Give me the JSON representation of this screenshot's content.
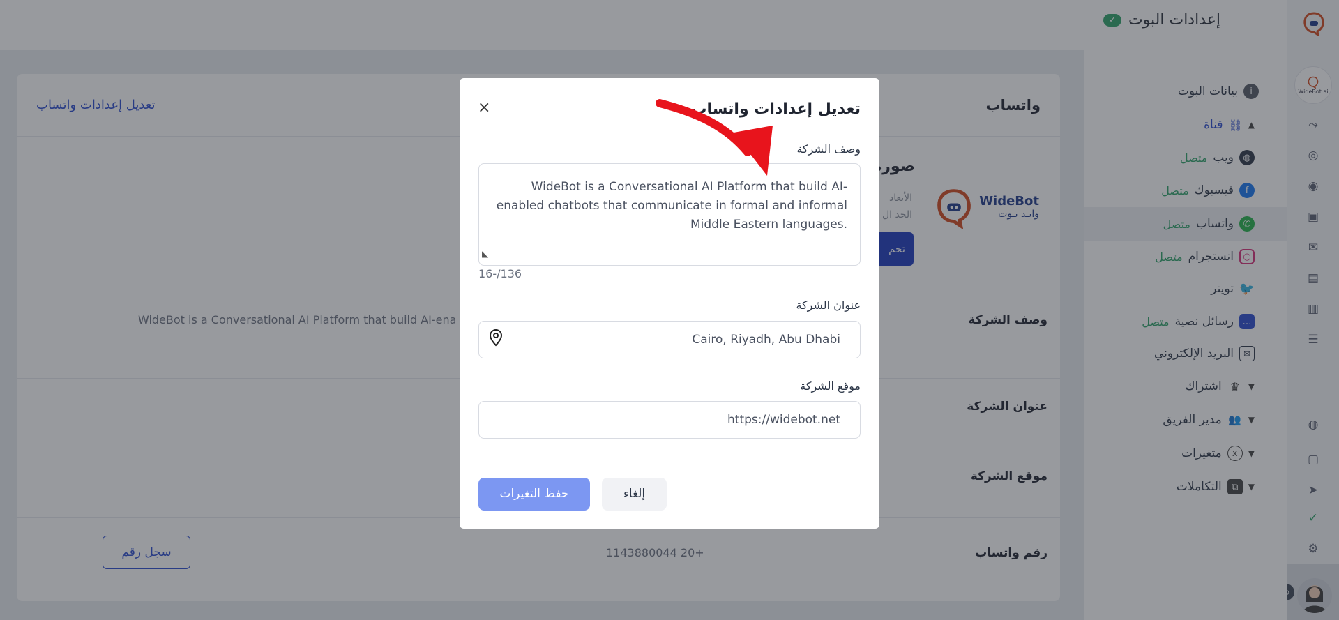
{
  "header": {
    "title": "إعدادات البوت"
  },
  "rail": {
    "logo_text": "WideBot.ai"
  },
  "sidebar": {
    "items": [
      {
        "label": "بيانات البوت"
      },
      {
        "label": "قناة"
      },
      {
        "label": "ويب",
        "status": "متصل"
      },
      {
        "label": "فيسبوك",
        "status": "متصل"
      },
      {
        "label": "واتساب",
        "status": "متصل"
      },
      {
        "label": "انستجرام",
        "status": "متصل"
      },
      {
        "label": "تويتر"
      },
      {
        "label": "رسائل نصية",
        "status": "متصل"
      },
      {
        "label": "البريد الإلكتروني"
      },
      {
        "label": "اشتراك"
      },
      {
        "label": "مدير الفريق"
      },
      {
        "label": "متغيرات"
      },
      {
        "label": "التكاملات"
      }
    ]
  },
  "main": {
    "title": "واتساب",
    "edit_link": "تعديل إعدادات واتساب",
    "logo_en": "WideBot",
    "logo_ar": "وايـد بـوت",
    "image_title": "صورة",
    "image_sub1": "الأبعاد",
    "image_sub2": "الحد ال",
    "upload_button": "تحم",
    "rows": [
      {
        "label": "وصف الشركة",
        "value": "WideBot is a Conversational AI Platform that build AI-ena"
      },
      {
        "label": "عنوان الشركة",
        "value": ""
      },
      {
        "label": "موقع الشركة",
        "value": ""
      },
      {
        "label": "رقم واتساب",
        "value": "1143880044 20+",
        "button": "سجل رقم"
      }
    ]
  },
  "modal": {
    "title": "تعديل إعدادات واتساب",
    "close": "×",
    "description_label": "وصف الشركة",
    "description_value": "WideBot is a Conversational AI Platform that build AI-enabled chatbots that communicate in formal and informal Middle Eastern languages.",
    "counter": "16-/136",
    "address_label": "عنوان الشركة",
    "address_value": "Cairo, Riyadh, Abu Dhabi",
    "website_label": "موقع الشركة",
    "website_value": "https://widebot.net",
    "cancel_button": "إلغاء",
    "save_button": "حفظ التغيرات"
  },
  "colors": {
    "accent": "#2b4ccf",
    "connected": "#2fa36a",
    "save_button": "#7c97f2",
    "annotation_arrow": "#e8141c"
  }
}
